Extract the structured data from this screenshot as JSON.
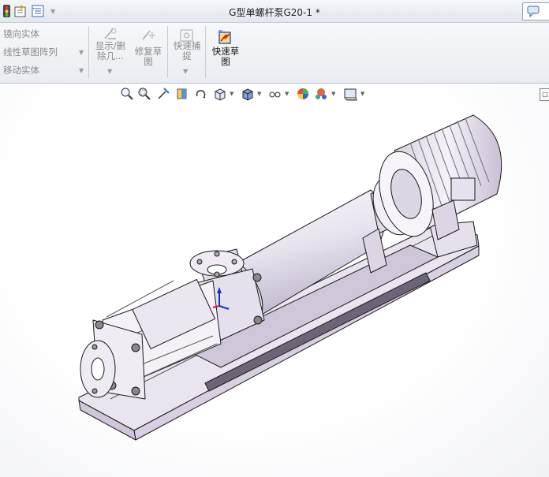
{
  "window": {
    "title": "G型单螺杆泵G20-1 *"
  },
  "quick_access": {
    "icons": [
      "traffic-light-icon",
      "options-icon",
      "properties-icon",
      "dropdown-arrow-icon"
    ]
  },
  "ribbon": {
    "menu_items": [
      {
        "label": "镜向实体",
        "has_dropdown": false
      },
      {
        "label": "线性草图阵列",
        "has_dropdown": true
      },
      {
        "label": "移动实体",
        "has_dropdown": true
      }
    ],
    "tools": [
      {
        "label_line1": "显示/删",
        "label_line2": "除几...",
        "label_line3": "",
        "enabled": false
      },
      {
        "label_line1": "修复草",
        "label_line2": "图",
        "label_line3": "",
        "enabled": false
      },
      {
        "label_line1": "快速捕",
        "label_line2": "捉",
        "label_line3": "",
        "enabled": false
      },
      {
        "label_line1": "快速草",
        "label_line2": "图",
        "label_line3": "",
        "enabled": true
      }
    ]
  },
  "heads_up_toolbar": {
    "icons": [
      "zoom-to-fit-icon",
      "zoom-to-area-icon",
      "previous-view-icon",
      "section-view-icon",
      "dynamic-annotation-icon",
      "view-orientation-icon",
      "display-style-icon",
      "hide-show-items-icon",
      "edit-appearance-icon",
      "apply-scene-icon",
      "view-settings-icon"
    ]
  },
  "colors": {
    "model_face": "#e7e2ec",
    "model_edge": "#1a1a1a",
    "triad_blue": "#1030d0",
    "triad_red": "#d02020"
  }
}
